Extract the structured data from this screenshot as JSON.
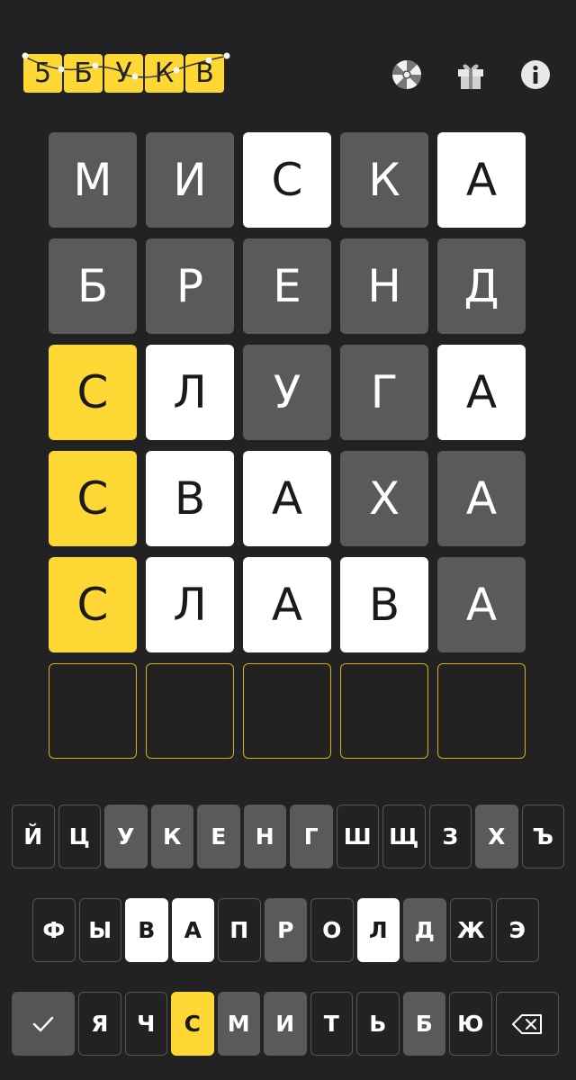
{
  "header": {
    "logo_letters": [
      "5",
      "Б",
      "У",
      "К",
      "В"
    ],
    "icons": [
      "wheel-icon",
      "gift-icon",
      "info-icon"
    ]
  },
  "board": [
    [
      {
        "l": "М",
        "s": "gray"
      },
      {
        "l": "И",
        "s": "gray"
      },
      {
        "l": "С",
        "s": "white"
      },
      {
        "l": "К",
        "s": "gray"
      },
      {
        "l": "А",
        "s": "white"
      }
    ],
    [
      {
        "l": "Б",
        "s": "gray"
      },
      {
        "l": "Р",
        "s": "gray"
      },
      {
        "l": "Е",
        "s": "gray"
      },
      {
        "l": "Н",
        "s": "gray"
      },
      {
        "l": "Д",
        "s": "gray"
      }
    ],
    [
      {
        "l": "С",
        "s": "yellow"
      },
      {
        "l": "Л",
        "s": "white"
      },
      {
        "l": "У",
        "s": "gray"
      },
      {
        "l": "Г",
        "s": "gray"
      },
      {
        "l": "А",
        "s": "white"
      }
    ],
    [
      {
        "l": "С",
        "s": "yellow"
      },
      {
        "l": "В",
        "s": "white"
      },
      {
        "l": "А",
        "s": "white"
      },
      {
        "l": "Х",
        "s": "gray"
      },
      {
        "l": "А",
        "s": "gray"
      }
    ],
    [
      {
        "l": "С",
        "s": "yellow"
      },
      {
        "l": "Л",
        "s": "white"
      },
      {
        "l": "А",
        "s": "white"
      },
      {
        "l": "В",
        "s": "white"
      },
      {
        "l": "А",
        "s": "gray"
      }
    ],
    [
      {
        "l": "",
        "s": "empty"
      },
      {
        "l": "",
        "s": "empty"
      },
      {
        "l": "",
        "s": "empty"
      },
      {
        "l": "",
        "s": "empty"
      },
      {
        "l": "",
        "s": "empty"
      }
    ]
  ],
  "keyboard": {
    "row1": [
      {
        "k": "Й",
        "s": "dark"
      },
      {
        "k": "Ц",
        "s": "dark"
      },
      {
        "k": "У",
        "s": "gray"
      },
      {
        "k": "К",
        "s": "gray"
      },
      {
        "k": "Е",
        "s": "gray"
      },
      {
        "k": "Н",
        "s": "gray"
      },
      {
        "k": "Г",
        "s": "gray"
      },
      {
        "k": "Ш",
        "s": "dark"
      },
      {
        "k": "Щ",
        "s": "dark"
      },
      {
        "k": "З",
        "s": "dark"
      },
      {
        "k": "Х",
        "s": "gray"
      },
      {
        "k": "Ъ",
        "s": "dark"
      }
    ],
    "row2": [
      {
        "k": "Ф",
        "s": "dark"
      },
      {
        "k": "Ы",
        "s": "dark"
      },
      {
        "k": "В",
        "s": "white"
      },
      {
        "k": "А",
        "s": "white"
      },
      {
        "k": "П",
        "s": "dark"
      },
      {
        "k": "Р",
        "s": "gray"
      },
      {
        "k": "О",
        "s": "dark"
      },
      {
        "k": "Л",
        "s": "white"
      },
      {
        "k": "Д",
        "s": "gray"
      },
      {
        "k": "Ж",
        "s": "dark"
      },
      {
        "k": "Э",
        "s": "dark"
      }
    ],
    "row3": [
      {
        "k": "Я",
        "s": "dark"
      },
      {
        "k": "Ч",
        "s": "dark"
      },
      {
        "k": "С",
        "s": "yellow"
      },
      {
        "k": "М",
        "s": "gray"
      },
      {
        "k": "И",
        "s": "gray"
      },
      {
        "k": "Т",
        "s": "dark"
      },
      {
        "k": "Ь",
        "s": "dark"
      },
      {
        "k": "Б",
        "s": "gray"
      },
      {
        "k": "Ю",
        "s": "dark"
      }
    ],
    "enter_icon": "check-icon",
    "backspace_icon": "backspace-icon"
  },
  "colors": {
    "background": "#222222",
    "gray": "#5a5a5a",
    "white": "#ffffff",
    "yellow": "#fdd835",
    "empty_border": "#d7b20a"
  }
}
